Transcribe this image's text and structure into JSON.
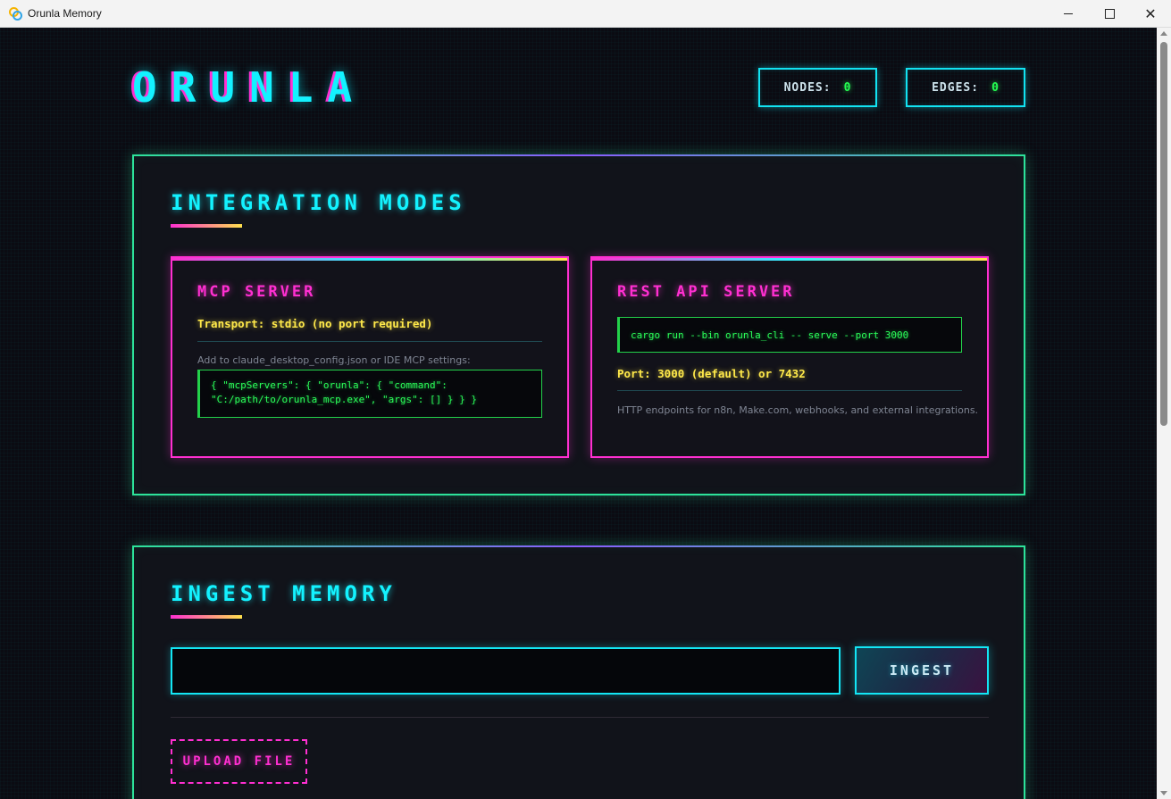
{
  "window": {
    "title": "Orunla Memory",
    "controls": {
      "minimize": "minimize",
      "maximize": "maximize",
      "close": "✕"
    }
  },
  "header": {
    "logo": "ORUNLA",
    "stats": {
      "nodes_label": "NODES:",
      "nodes_value": "0",
      "edges_label": "EDGES:",
      "edges_value": "0"
    }
  },
  "integration": {
    "title": "INTEGRATION MODES",
    "mcp": {
      "title": "MCP SERVER",
      "transport": "Transport: stdio (no port required)",
      "hint": "Add to claude_desktop_config.json or IDE MCP settings:",
      "config_line1": "{ \"mcpServers\": { \"orunla\": { \"command\":",
      "config_line2": "\"C:/path/to/orunla_mcp.exe\", \"args\": [] } } }"
    },
    "rest": {
      "title": "REST API SERVER",
      "command": "cargo run --bin orunla_cli -- serve --port 3000",
      "port": "Port: 3000 (default) or 7432",
      "description": "HTTP endpoints for n8n, Make.com, webhooks, and external integrations."
    }
  },
  "ingest": {
    "title": "INGEST MEMORY",
    "input_value": "",
    "button_label": "INGEST",
    "upload_label": "UPLOAD FILE"
  },
  "colors": {
    "cyan": "#13f2ff",
    "magenta": "#ff2fd1",
    "neon_green": "#2de39a",
    "code_green": "#2bff5a",
    "yellow": "#ffe94a",
    "background": "#0b0b12"
  },
  "icons": {
    "app": "app-logo-icon",
    "minimize": "minimize-icon",
    "maximize": "maximize-icon",
    "close": "close-icon"
  }
}
